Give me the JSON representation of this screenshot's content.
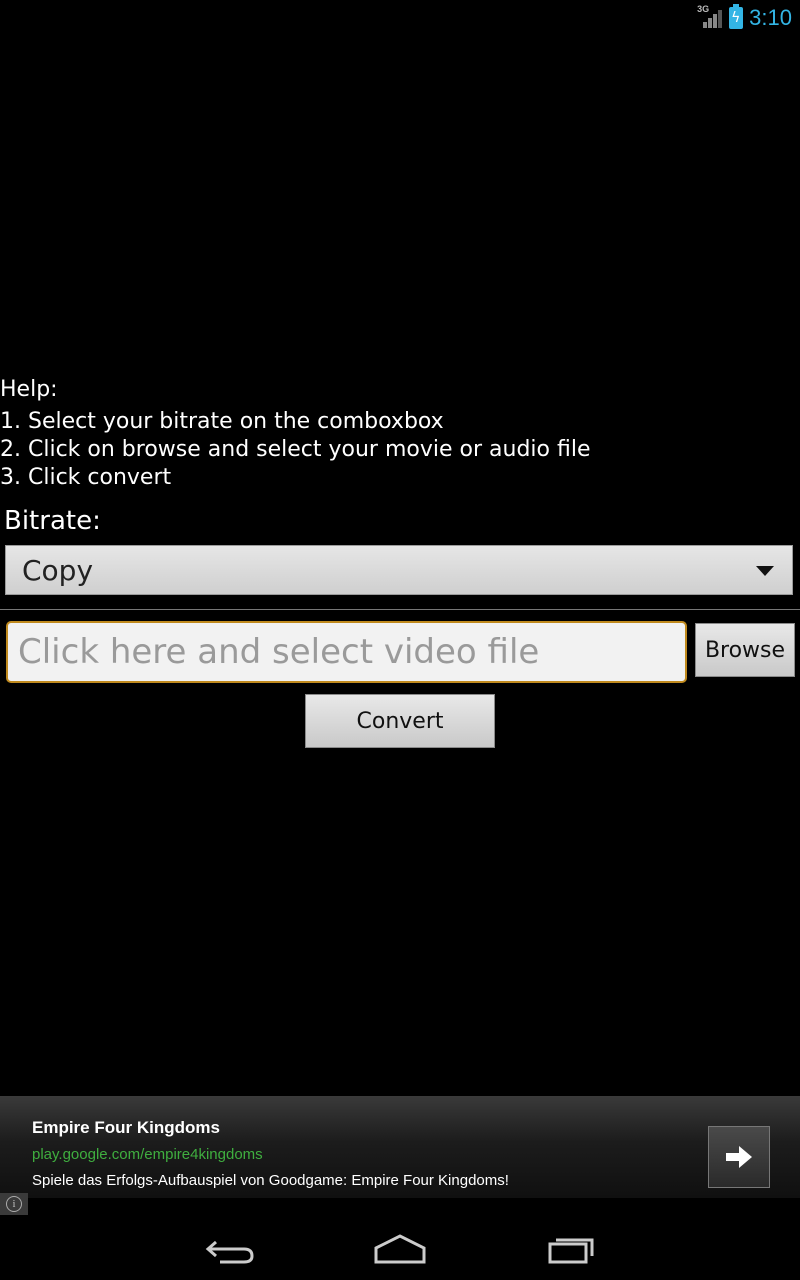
{
  "status_bar": {
    "network": "3G",
    "time": "3:10"
  },
  "help": {
    "title": "Help:",
    "steps": [
      "1. Select your bitrate on the comboxbox",
      "2. Click on browse and select your movie or audio file",
      "3. Click convert"
    ]
  },
  "bitrate": {
    "label": "Bitrate:",
    "selected": "Copy"
  },
  "file": {
    "placeholder": "Click here and select video file",
    "browse_label": "Browse"
  },
  "convert_label": "Convert",
  "ad": {
    "title": "Empire Four Kingdoms",
    "url": "play.google.com/empire4kingdoms",
    "description": "Spiele das Erfolgs-Aufbauspiel von Goodgame: Empire Four Kingdoms!"
  },
  "colors": {
    "accent": "#33b5e5",
    "ad_url": "#3fae3f",
    "input_border": "#c08a1e"
  }
}
